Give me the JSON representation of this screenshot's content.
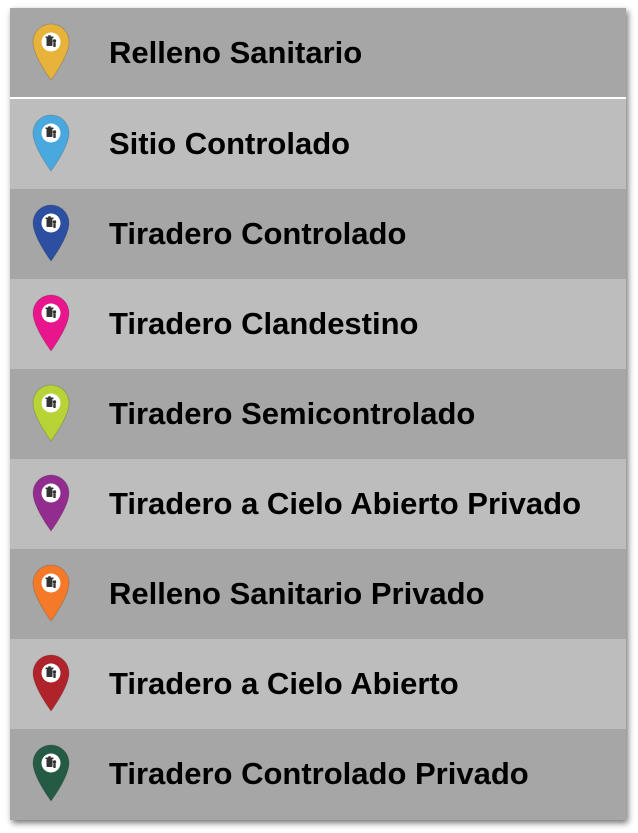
{
  "legend": {
    "items": [
      {
        "label": "Relleno Sanitario",
        "icon": "map-pin-icon",
        "color": "#E8B33A",
        "row_bg": "#A6A6A6"
      },
      {
        "label": "Sitio Controlado",
        "icon": "map-pin-icon",
        "color": "#49A9DF",
        "row_bg": "#BDBDBD"
      },
      {
        "label": "Tiradero Controlado",
        "icon": "map-pin-icon",
        "color": "#2D4FA1",
        "row_bg": "#A6A6A6"
      },
      {
        "label": "Tiradero Clandestino",
        "icon": "map-pin-icon",
        "color": "#E8158C",
        "row_bg": "#BDBDBD"
      },
      {
        "label": "Tiradero Semicontrolado",
        "icon": "map-pin-icon",
        "color": "#B7D335",
        "row_bg": "#A6A6A6"
      },
      {
        "label": "Tiradero a Cielo Abierto Privado",
        "icon": "map-pin-icon",
        "color": "#922C8F",
        "row_bg": "#BDBDBD"
      },
      {
        "label": "Relleno Sanitario Privado",
        "icon": "map-pin-icon",
        "color": "#F47A2A",
        "row_bg": "#A6A6A6"
      },
      {
        "label": "Tiradero a Cielo Abierto",
        "icon": "map-pin-icon",
        "color": "#B1232B",
        "row_bg": "#BDBDBD"
      },
      {
        "label": "Tiradero Controlado Privado",
        "icon": "map-pin-icon",
        "color": "#255A44",
        "row_bg": "#A6A6A6"
      }
    ]
  }
}
